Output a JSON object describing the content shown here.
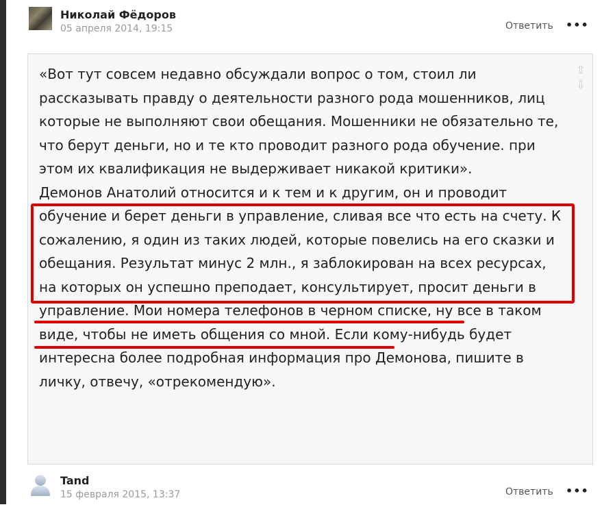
{
  "comments": [
    {
      "author": "Николай Фёдоров",
      "date": "05 апреля 2014, 19:15",
      "reply_label": "Ответить",
      "more_label": "•••",
      "paragraphs": [
        "«Вот тут совсем недавно обсуждали вопрос о том, стоил ли рассказывать правду о деятельности разного рода мошенников, лиц которые не выполняют свои обещания. Мошенники не обязательно те, что берут деньги, но и те кто проводит разного рода обучение. при этом их квалификация не выдерживает никакой критики».",
        "Демонов Анатолий относится и к тем и к другим, он и проводит обучение и берет деньги в управление, сливая все что есть на счету. К сожалению, я один из таких людей, которые повелись на его сказки и обещания. Результат минус 2 млн., я заблокирован на всех ресурсах, на которых он успешно преподает, консультирует, просит деньги в управление. Мои номера телефонов в черном списке, ну все в таком виде, чтобы не иметь общения со мной. Если кому-нибудь будет интересна более подробная информация про Демонова, пишите в личку, отвечу, «отрекомендую»."
      ],
      "vote_up_icon": "arrow-up-icon",
      "vote_down_icon": "arrow-down-icon"
    },
    {
      "author": "Tand",
      "date": "15 февраля 2015, 13:37",
      "reply_label": "Ответить",
      "more_label": "•••"
    }
  ],
  "colors": {
    "highlight": "#e00000",
    "date": "#9a9a9a",
    "box_bg": "#f7f7f7"
  }
}
